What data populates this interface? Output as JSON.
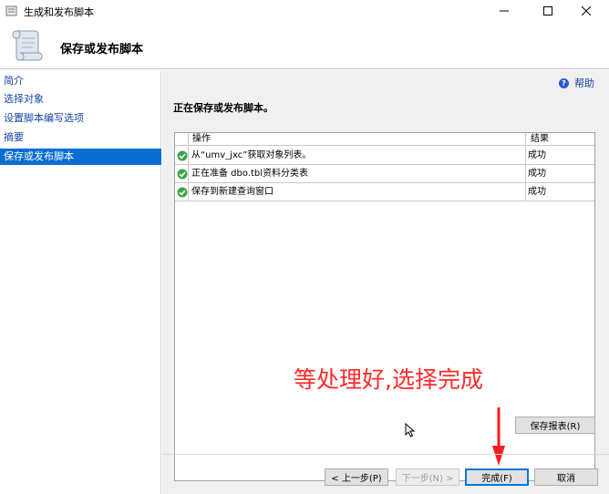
{
  "window": {
    "title": "生成和发布脚本",
    "minimize_glyph": "—",
    "maximize_glyph": "☐",
    "close_glyph": "✕"
  },
  "header": {
    "heading": "保存或发布脚本"
  },
  "sidebar": {
    "items": [
      {
        "label": "简介",
        "selected": false
      },
      {
        "label": "选择对象",
        "selected": false
      },
      {
        "label": "设置脚本编写选项",
        "selected": false
      },
      {
        "label": "摘要",
        "selected": false
      },
      {
        "label": "保存或发布脚本",
        "selected": true
      }
    ]
  },
  "main": {
    "help_label": "帮助",
    "help_icon_glyph": "?",
    "status_text": "正在保存或发布脚本。",
    "grid": {
      "columns": {
        "operation": "操作",
        "result": "结果"
      },
      "rows": [
        {
          "operation": "从“umv_jxc”获取对象列表。",
          "result": "成功"
        },
        {
          "operation": "正在准备 dbo.tbl资料分类表",
          "result": "成功"
        },
        {
          "operation": "保存到新建查询窗口",
          "result": "成功"
        }
      ]
    },
    "annotation": "等处理好,选择完成",
    "accent_color": "#ff2a2a"
  },
  "buttons": {
    "save_report": "保存报表(R)",
    "previous": "< 上一步(P)",
    "next": "下一步(N) >",
    "finish": "完成(F)",
    "cancel": "取消"
  }
}
